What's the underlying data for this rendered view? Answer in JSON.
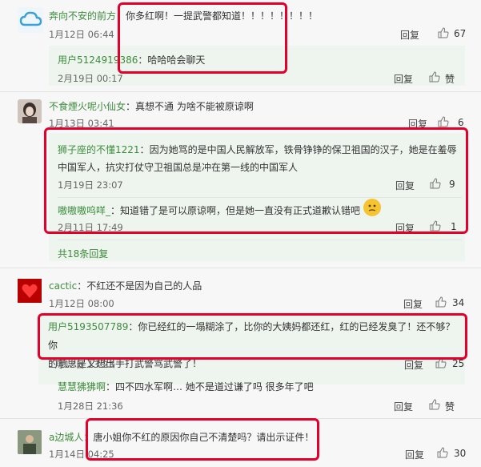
{
  "comments": [
    {
      "name": "奔向不安的前方",
      "text": "你多红啊！一提武警都知道！！！！！！！！",
      "time": "1月12日 06:44",
      "reply": "回复",
      "likes": "67",
      "avatar_icon": "cloud-icon"
    },
    {
      "name": "不食煙火呢小仙女",
      "text": "真想不通 为啥不能被原谅啊",
      "time": "1月13日 03:41",
      "reply": "回复",
      "likes": "6",
      "avatar_icon": "portrait-icon"
    },
    {
      "name": "cactic",
      "text": "不红还不是因为自己的人品",
      "time": "1月12日 08:00",
      "reply": "回复",
      "likes": "34",
      "avatar_icon": "heart-icon"
    },
    {
      "name": "用户5193507789",
      "text_line1": "你已经红的一塌糊涂了，比你的大姨妈都还红，红的已经发臭了！还不够？你",
      "text_line2": "的意思是又想出手打武警骂武警了！",
      "time": "1月12日 13:23",
      "reply": "回复",
      "likes": "25"
    },
    {
      "name": "a边城人",
      "text": "唐小姐你不红的原因你自己不清楚吗？请出示证件！",
      "time": "1月14日 04:25",
      "reply": "回复",
      "likes": "30",
      "avatar_icon": "person-photo-icon"
    }
  ],
  "replies": [
    {
      "name": "用户5124919386",
      "text": "哈哈哈会聊天",
      "time": "2月19日 00:17",
      "reply": "回复",
      "likes": "赞"
    },
    {
      "name": "狮子座的不懂1221",
      "text_line1": "因为她骂的是中国人民解放军，铁骨铮铮的保卫祖国的汉子，她是在羞辱",
      "text_line2": "中国军人，抗灾打仗守卫祖国总是冲在第一线的中国军人",
      "time": "1月19日 23:07",
      "reply": "回复",
      "likes": "9"
    },
    {
      "name": "嗷嗷嗷呜咩_",
      "text": "知道错了是可以原谅啊，但是她一直没有正式道歉认错吧",
      "emoji": "🤔",
      "time": "2月11日 17:49",
      "reply": "回复",
      "likes": "1"
    },
    {
      "name": "慧慧狒狒啊",
      "text": "四不四水军啊… 她不是道过谦了吗 很多年了吧",
      "time": "1月28日 21:36",
      "reply": "回复",
      "likes": "赞"
    }
  ],
  "more_replies": "共18条回复",
  "colors": {
    "highlight": "#e4002b",
    "username": "#3d8d3d"
  }
}
